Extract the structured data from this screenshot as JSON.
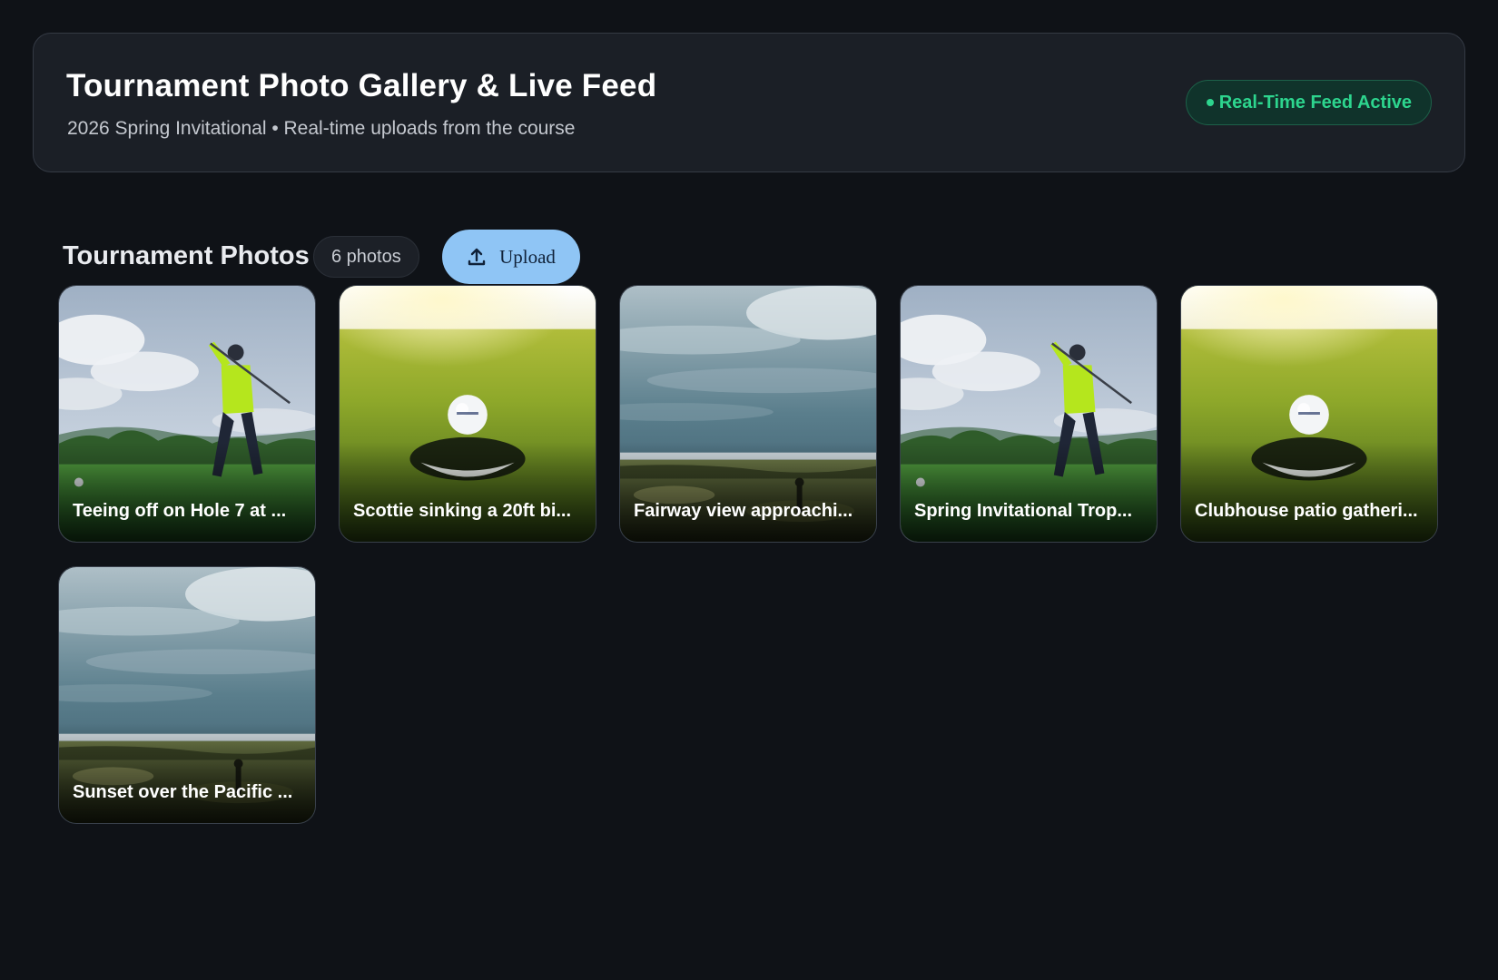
{
  "header": {
    "title": "Tournament Photo Gallery & Live Feed",
    "subtitle": "2026 Spring Invitational • Real-time uploads from the course",
    "status_label": "Real-Time Feed Active"
  },
  "gallery": {
    "section_title": "Tournament Photos",
    "count_label": "6 photos",
    "upload_label": "Upload",
    "photos": [
      {
        "caption": "Teeing off on Hole 7 at ...",
        "scene": "golfer-swing"
      },
      {
        "caption": "Scottie sinking a 20ft bi...",
        "scene": "ball-at-hole"
      },
      {
        "caption": "Fairway view approachi...",
        "scene": "links-sky"
      },
      {
        "caption": "Spring Invitational Trop...",
        "scene": "golfer-swing"
      },
      {
        "caption": "Clubhouse patio gatheri...",
        "scene": "ball-at-hole"
      },
      {
        "caption": "Sunset over the Pacific ...",
        "scene": "links-sky"
      }
    ]
  },
  "colors": {
    "background": "#0f1217",
    "card": "#1b1f26",
    "accent_blue": "#8fc5f5",
    "status_green": "#2dd58e"
  }
}
